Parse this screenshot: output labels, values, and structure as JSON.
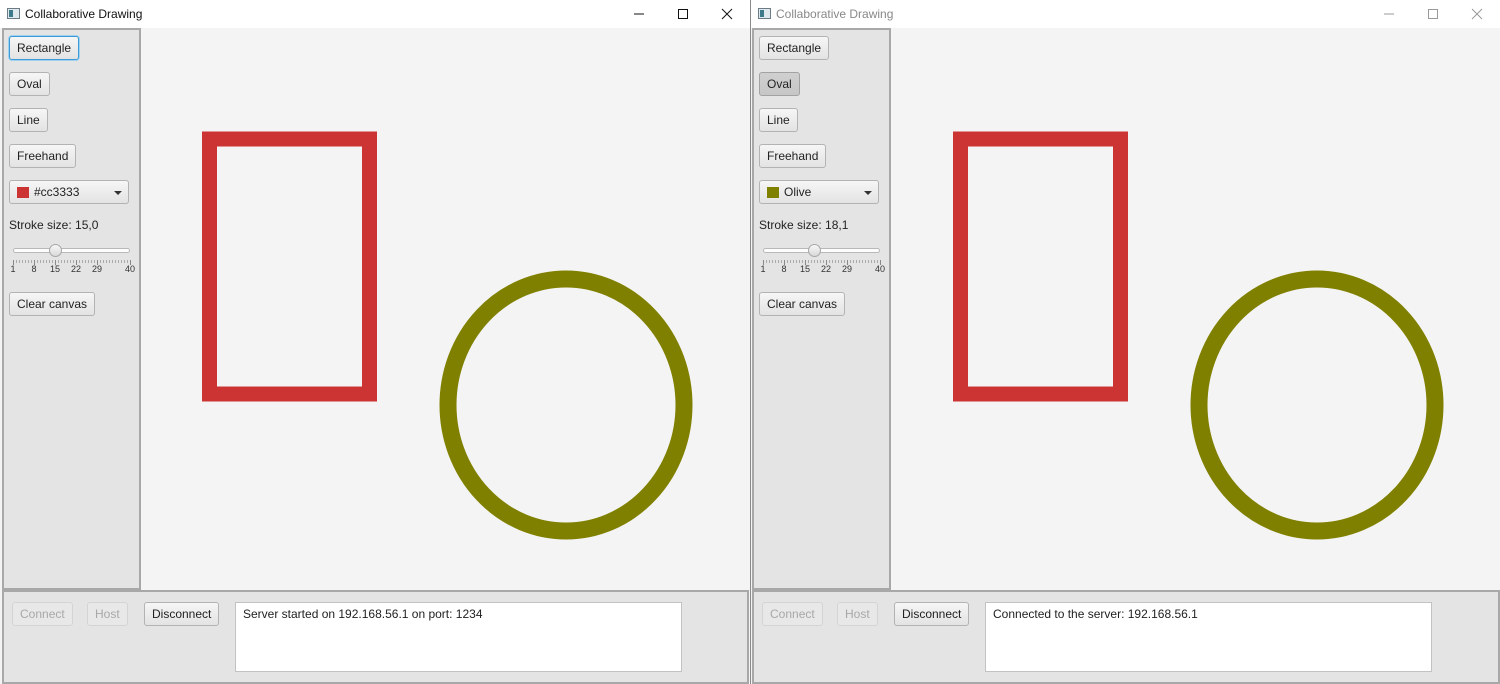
{
  "windows": [
    {
      "id": "left",
      "title": "Collaborative Drawing",
      "tools": [
        "Rectangle",
        "Oval",
        "Line",
        "Freehand"
      ],
      "active_tool": "Rectangle",
      "color": {
        "label": "#cc3333",
        "value": "#cc3333"
      },
      "stroke_label": "Stroke size: 15,0",
      "stroke_value": 15.0,
      "slider": {
        "min": 1,
        "max": 40,
        "ticks": [
          "1",
          "8",
          "15",
          "22",
          "29",
          "40"
        ]
      },
      "clear_label": "Clear canvas",
      "network": {
        "connect": "Connect",
        "host": "Host",
        "disconnect": "Disconnect"
      },
      "status": "Server started on 192.168.56.1 on port: 1234"
    },
    {
      "id": "right",
      "title": "Collaborative Drawing",
      "tools": [
        "Rectangle",
        "Oval",
        "Line",
        "Freehand"
      ],
      "active_tool": "Oval",
      "color": {
        "label": "Olive",
        "value": "#808000"
      },
      "stroke_label": "Stroke size: 18,1",
      "stroke_value": 18.1,
      "slider": {
        "min": 1,
        "max": 40,
        "ticks": [
          "1",
          "8",
          "15",
          "22",
          "29",
          "40"
        ]
      },
      "clear_label": "Clear canvas",
      "network": {
        "connect": "Connect",
        "host": "Host",
        "disconnect": "Disconnect"
      },
      "status": "Connected to the server: 192.168.56.1"
    }
  ],
  "shapes": [
    {
      "type": "rectangle",
      "color": "#cc3333"
    },
    {
      "type": "oval",
      "color": "#808000"
    }
  ],
  "icons": [
    "app-icon",
    "minimize-icon",
    "maximize-icon",
    "close-icon",
    "chevron-down-icon"
  ]
}
